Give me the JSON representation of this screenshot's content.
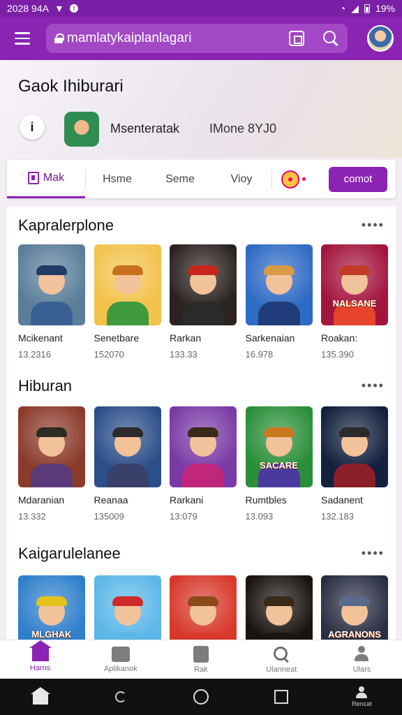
{
  "status": {
    "time": "2028 94A",
    "battery": "19%"
  },
  "appbar": {
    "url": "mamlatykaiplanlagari"
  },
  "hero": {
    "title": "Gaok Ihiburari",
    "back_glyph": "i",
    "app_name": "Msenteratak",
    "app_meta": "IMone 8YJ0"
  },
  "tabs": [
    {
      "label": "Mak"
    },
    {
      "label": "Hsme"
    },
    {
      "label": "Seme"
    },
    {
      "label": "Vioy"
    }
  ],
  "cta_label": "comot",
  "sections": [
    {
      "title": "Kapralerplone",
      "more": "••••",
      "games": [
        {
          "name": "Mcikenant",
          "count": "13.2316",
          "bg": "#5a7e9a",
          "hat": "#1f3b66",
          "body": "#3a5f93",
          "banner": ""
        },
        {
          "name": "Senetbare",
          "count": "152070",
          "bg": "#f3c24b",
          "hat": "#c9701e",
          "body": "#3e9a3c",
          "banner": ""
        },
        {
          "name": "Rarkan",
          "count": "133.33",
          "bg": "#2b2320",
          "hat": "#c7261e",
          "body": "#2a2a2a",
          "banner": ""
        },
        {
          "name": "Sarkenaian",
          "count": "16.978",
          "bg": "#2f6bc4",
          "hat": "#d99a45",
          "body": "#203c7a",
          "banner": ""
        },
        {
          "name": "Roakan:",
          "count": "135.390",
          "bg": "#a3153d",
          "hat": "#c23b27",
          "body": "#e7442c",
          "banner": "NALSANE"
        }
      ]
    },
    {
      "title": "Hiburan",
      "more": "••••",
      "games": [
        {
          "name": "Mdaranian",
          "count": "13.332",
          "bg": "#8b3b2a",
          "hat": "#2e2b24",
          "body": "#5a3a7a",
          "banner": ""
        },
        {
          "name": "Reanaa",
          "count": "135009",
          "bg": "#2c4f8a",
          "hat": "#2a2a2a",
          "body": "#39406a",
          "banner": ""
        },
        {
          "name": "Rarkani",
          "count": "13:079",
          "bg": "#7a3aa6",
          "hat": "#3a2a1a",
          "body": "#c0267a",
          "banner": ""
        },
        {
          "name": "Rumtbles",
          "count": "13.093",
          "bg": "#2b8f3a",
          "hat": "#c9781e",
          "body": "#4a3aa0",
          "banner": "SACARE"
        },
        {
          "name": "Sadanent",
          "count": "132.183",
          "bg": "#13203e",
          "hat": "#2a2a2a",
          "body": "#8a1f2a",
          "banner": ""
        }
      ]
    },
    {
      "title": "Kaigarulelanee",
      "more": "••••",
      "games": [
        {
          "name": "",
          "count": "",
          "bg": "#2f7fcb",
          "hat": "#e6c21f",
          "body": "#2f7fcb",
          "banner": "MLGHAK"
        },
        {
          "name": "",
          "count": "",
          "bg": "#5bb7e8",
          "hat": "#d12a2a",
          "body": "#5bb7e8",
          "banner": ""
        },
        {
          "name": "",
          "count": "",
          "bg": "#d8382a",
          "hat": "#8a4a1a",
          "body": "#d8382a",
          "banner": ""
        },
        {
          "name": "",
          "count": "",
          "bg": "#1a1410",
          "hat": "#3a2a1a",
          "body": "#1a1410",
          "banner": ""
        },
        {
          "name": "",
          "count": "",
          "bg": "#2a2f44",
          "hat": "#5a6a8a",
          "body": "#2a2f44",
          "banner": "AGRANONS"
        }
      ]
    }
  ],
  "bottomnav": [
    {
      "label": "Harns",
      "icon": "home-icon"
    },
    {
      "label": "Aplikanok",
      "icon": "apps-icon"
    },
    {
      "label": "Rak",
      "icon": "library-icon"
    },
    {
      "label": "Ulanneat",
      "icon": "search-icon"
    },
    {
      "label": "Ulars",
      "icon": "user-icon"
    }
  ],
  "sysnav": {
    "account_label": "Rencat"
  },
  "colors": {
    "primary": "#8b23b3",
    "statusbar": "#7a1fa6",
    "surface": "#ffffff"
  }
}
